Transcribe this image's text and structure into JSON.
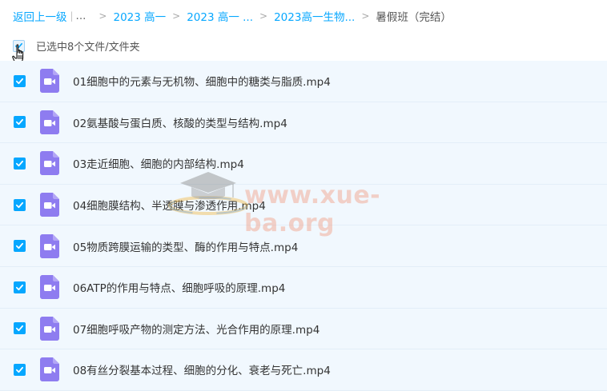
{
  "breadcrumb": {
    "back": "返回上一级",
    "ellipsis": "...",
    "items": [
      "2023 高一",
      "2023 高一 ...",
      "2023高一生物..."
    ],
    "current": "暑假班（完结）"
  },
  "selection": {
    "summary": "已选中8个文件/文件夹"
  },
  "icons": {
    "checkbox": "checkbox-checked-icon",
    "file": "video-file-icon",
    "cursor": "hand-pointer-icon"
  },
  "colors": {
    "accent": "#06a7ff",
    "row_bg": "#f1f8fe",
    "video_icon": "#8e7cf0"
  },
  "files": [
    {
      "name": "01细胞中的元素与无机物、细胞中的糖类与脂质.mp4",
      "checked": true
    },
    {
      "name": "02氨基酸与蛋白质、核酸的类型与结构.mp4",
      "checked": true
    },
    {
      "name": "03走近细胞、细胞的内部结构.mp4",
      "checked": true
    },
    {
      "name": "04细胞膜结构、半透膜与渗透作用.mp4",
      "checked": true
    },
    {
      "name": "05物质跨膜运输的类型、酶的作用与特点.mp4",
      "checked": true
    },
    {
      "name": "06ATP的作用与特点、细胞呼吸的原理.mp4",
      "checked": true
    },
    {
      "name": "07细胞呼吸产物的测定方法、光合作用的原理.mp4",
      "checked": true
    },
    {
      "name": "08有丝分裂基本过程、细胞的分化、衰老与死亡.mp4",
      "checked": true
    }
  ],
  "watermark": {
    "text": "www.xue-ba.org"
  }
}
